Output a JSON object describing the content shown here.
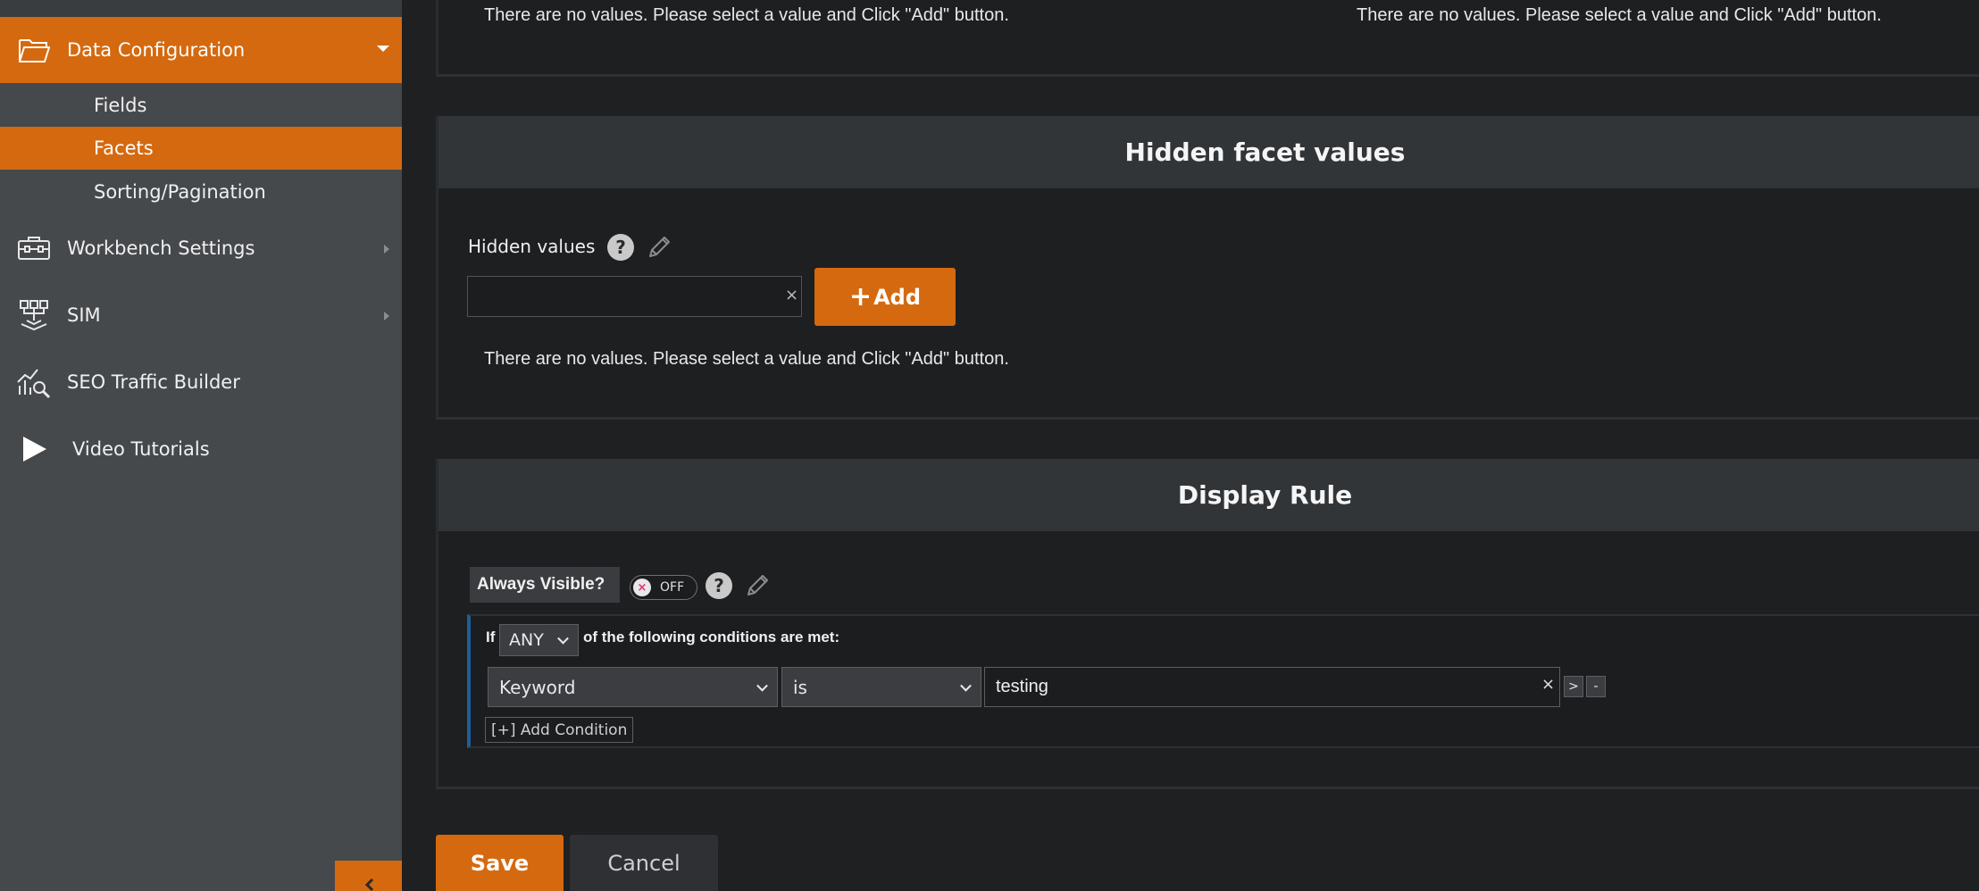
{
  "sidebar": {
    "data_configuration": "Data Configuration",
    "sub_items": [
      "Fields",
      "Facets",
      "Sorting/Pagination"
    ],
    "nav": [
      "Workbench Settings",
      "SIM",
      "SEO Traffic Builder",
      "Video Tutorials"
    ]
  },
  "top_messages": {
    "left": "There are no values. Please select a value and Click \"Add\" button.",
    "right": "There are no values. Please select a value and Click \"Add\" button."
  },
  "hidden_facet": {
    "title": "Hidden facet values",
    "field_label": "Hidden values",
    "help": "?",
    "input_value": "",
    "clear": "×",
    "add_plus": "+",
    "add_label": "Add",
    "empty_message": "There are no values. Please select a value and Click \"Add\" button."
  },
  "display_rule": {
    "title": "Display Rule",
    "always_visible_label": "Always Visible?",
    "toggle_state": "OFF",
    "toggle_x": "×",
    "help": "?",
    "if_label": "If",
    "match": "ANY",
    "conditions_text": "of the following conditions are met:",
    "condition": {
      "field": "Keyword",
      "operator": "is",
      "value": "testing",
      "clear": "×",
      "next": ">",
      "remove": "-"
    },
    "add_condition": "[+] Add Condition"
  },
  "footer": {
    "save": "Save",
    "cancel": "Cancel"
  },
  "colors": {
    "accent": "#d4690f",
    "sidebar_bg": "#46494c",
    "content_bg": "#1f2022",
    "condition_border": "#1f5e9c"
  }
}
